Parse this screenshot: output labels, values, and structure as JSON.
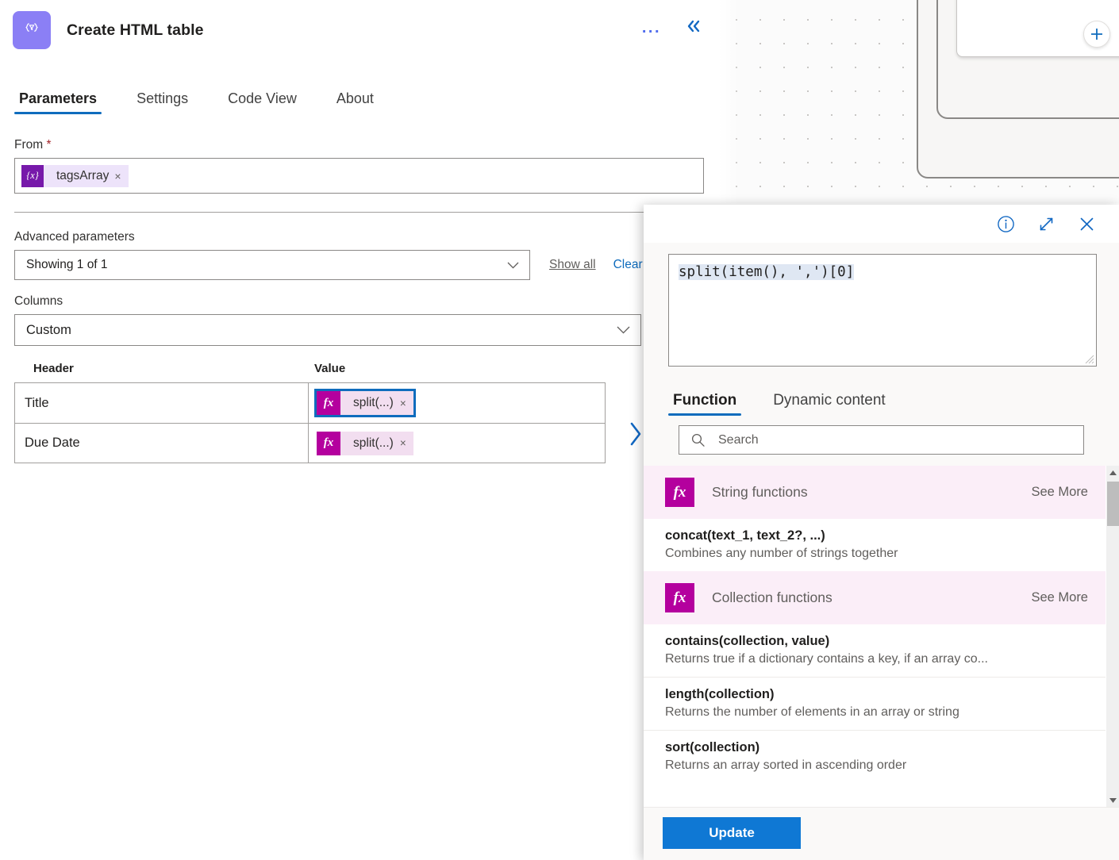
{
  "header": {
    "app_icon": "braces-filter-icon",
    "title": "Create HTML table",
    "more_label": "...",
    "collapse_label": "«"
  },
  "tabs": [
    {
      "label": "Parameters",
      "active": true
    },
    {
      "label": "Settings",
      "active": false
    },
    {
      "label": "Code View",
      "active": false
    },
    {
      "label": "About",
      "active": false
    }
  ],
  "form": {
    "from": {
      "label": "From",
      "required_mark": "*",
      "token": {
        "icon": "{x}",
        "text": "tagsArray",
        "remove": "×"
      }
    },
    "advanced": {
      "label": "Advanced parameters",
      "select_value": "Showing 1 of 1",
      "show_all": "Show all",
      "clear_all": "Clear all"
    },
    "columns": {
      "label": "Columns",
      "select_value": "Custom"
    },
    "table": {
      "col_header": "Header",
      "col_value": "Value",
      "rows": [
        {
          "header": "Title",
          "value_icon": "fx",
          "value_text": "split(...)",
          "remove": "×",
          "focused": true
        },
        {
          "header": "Due Date",
          "value_icon": "fx",
          "value_text": "split(...)",
          "remove": "×",
          "focused": false
        }
      ]
    }
  },
  "callout": {
    "actions": {
      "info": "info-icon",
      "expand": "expand-icon",
      "close": "close-icon"
    },
    "expression": "split(item(), ',')[0]",
    "tabs": [
      {
        "label": "Function",
        "active": true
      },
      {
        "label": "Dynamic content",
        "active": false
      }
    ],
    "search": {
      "placeholder": "Search",
      "value": "",
      "icon": "search-icon"
    },
    "list": [
      {
        "kind": "category",
        "icon": "fx",
        "label": "String functions",
        "more": "See More"
      },
      {
        "kind": "function",
        "name": "concat(text_1, text_2?, ...)",
        "desc": "Combines any number of strings together"
      },
      {
        "kind": "category",
        "icon": "fx",
        "label": "Collection functions",
        "more": "See More"
      },
      {
        "kind": "function",
        "name": "contains(collection, value)",
        "desc": "Returns true if a dictionary contains a key, if an array co..."
      },
      {
        "kind": "function",
        "name": "length(collection)",
        "desc": "Returns the number of elements in an array or string"
      },
      {
        "kind": "function",
        "name": "sort(collection)",
        "desc": "Returns an array sorted in ascending order"
      }
    ],
    "update_button": "Update"
  },
  "canvas": {
    "add_button": "+"
  },
  "colors": {
    "accent_blue": "#0f6cbd",
    "primary_button": "#0f78d4",
    "token_purple": "#7719aa",
    "token_purple_bg": "#ede3fa",
    "fx_magenta": "#b4009e",
    "fx_magenta_bg": "#f2def0",
    "category_bg": "#fbeef8",
    "app_icon_purple": "#8b7ff5",
    "required_red": "#a4262c"
  }
}
